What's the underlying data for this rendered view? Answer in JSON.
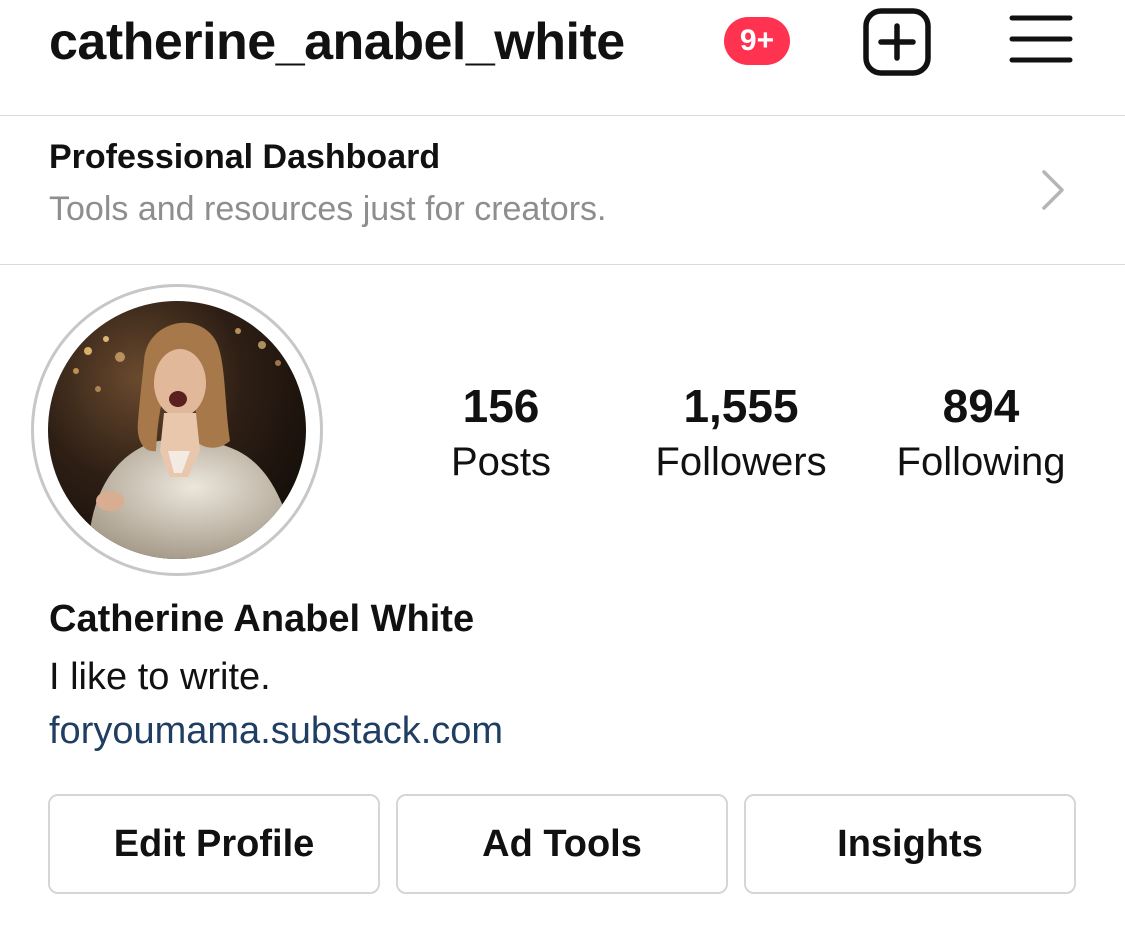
{
  "header": {
    "username": "catherine_anabel_white",
    "notification_badge": "9+",
    "new_post_icon": "plus-square-icon",
    "menu_icon": "hamburger-menu-icon",
    "badge_color": "#ff3250"
  },
  "dashboard": {
    "title": "Professional Dashboard",
    "subtitle": "Tools and resources just for creators.",
    "chevron_icon": "chevron-right-icon"
  },
  "profile": {
    "avatar_icon": "profile-photo",
    "stats": [
      {
        "value": "156",
        "label": "Posts"
      },
      {
        "value": "1,555",
        "label": "Followers"
      },
      {
        "value": "894",
        "label": "Following"
      }
    ],
    "full_name": "Catherine Anabel White",
    "bio": "I like to write.",
    "website": "foryoumama.substack.com",
    "link_color": "#1f3e62"
  },
  "actions": {
    "edit_profile": "Edit Profile",
    "ad_tools": "Ad Tools",
    "insights": "Insights"
  }
}
